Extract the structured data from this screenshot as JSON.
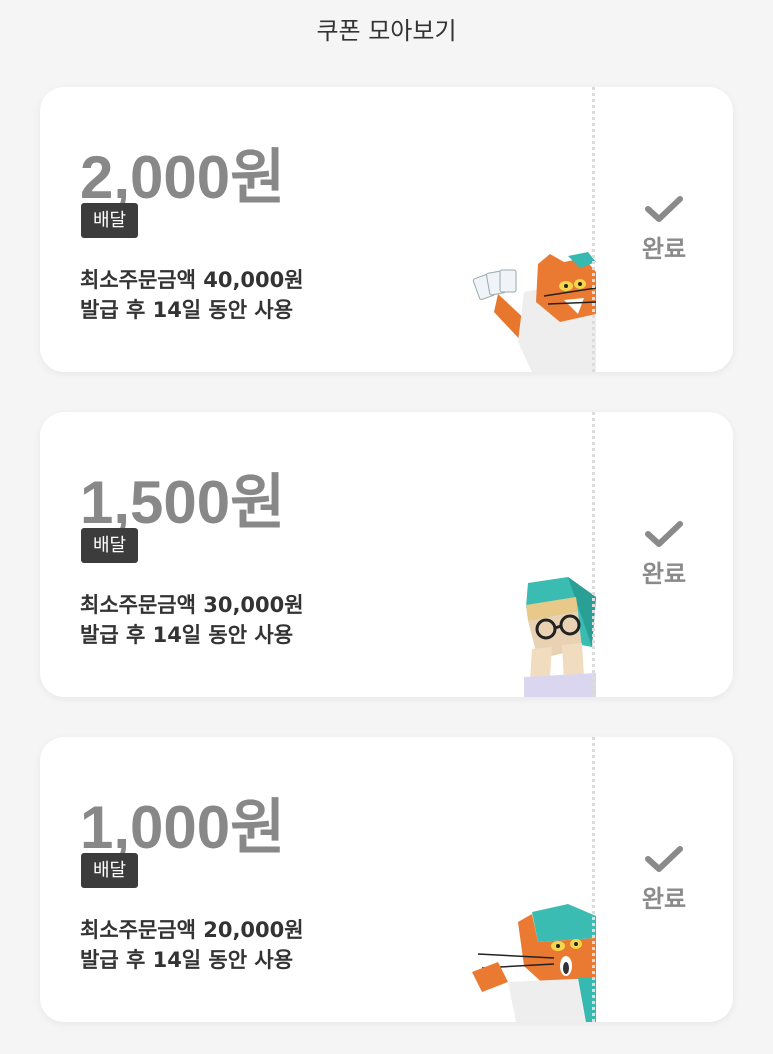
{
  "header": {
    "title": "쿠폰 모아보기"
  },
  "coupons": [
    {
      "amount": "2,000원",
      "badge": "배달",
      "min_order": "최소주문금액 40,000원",
      "validity": "발급 후 14일 동안 사용",
      "status": "완료",
      "illustration": "cat-holding-cards"
    },
    {
      "amount": "1,500원",
      "badge": "배달",
      "min_order": "최소주문금액 30,000원",
      "validity": "발급 후 14일 동안 사용",
      "status": "완료",
      "illustration": "character-with-glasses"
    },
    {
      "amount": "1,000원",
      "badge": "배달",
      "min_order": "최소주문금액 20,000원",
      "validity": "발급 후 14일 동안 사용",
      "status": "완료",
      "illustration": "cat-surprised"
    }
  ]
}
